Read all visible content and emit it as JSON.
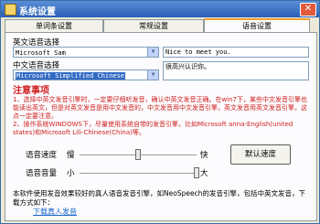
{
  "window": {
    "title": "系统设置"
  },
  "tabs": [
    {
      "label": "单词条设置"
    },
    {
      "label": "常规设置"
    },
    {
      "label": "语音设置"
    }
  ],
  "english_voice": {
    "label": "英文语音选择",
    "value": "Microsoft Sam",
    "sample_text": "Nice to meet you."
  },
  "chinese_voice": {
    "label": "中文语音选择",
    "value": "Microsoft Simplified Chinese",
    "sample_text": "很高兴认识你。"
  },
  "notes": {
    "title": "注意事项",
    "item1": "1、选择中英文发音引擎时，一定要仔细听发音，确认中英文发音正确。在win7下，某些中文发音引擎也能读出英文，但是对英文发音是用中文发音的，中文发音用中文发音引擎，英文发音用英文发音引擎，这点一定要注意。",
    "item2": "2、操作系统WINDOWS下，尽量使用系统自带的发音引擎，比如Microsoft anna-English(united states)和Microsoft Lili-Chinese(China)等。"
  },
  "speed": {
    "label": "语音速度",
    "min_label": "慢",
    "max_label": "快",
    "level": 0.5
  },
  "volume": {
    "label": "语音音量",
    "min_label": "小",
    "max_label": "大",
    "level": 1.0
  },
  "reset_button": {
    "label": "默认速度"
  },
  "footnote": "本软件使用发音效果较好的真人语音发音引擎，如NeoSpeech的发音引擎，包括中英文发音，下载方式如下：",
  "download_link": "下载真人发音",
  "colors": {
    "title_bar": "#2b5fb5",
    "note_red": "#d02020",
    "link_blue": "#1a66c8",
    "selection": "#316ac5"
  }
}
